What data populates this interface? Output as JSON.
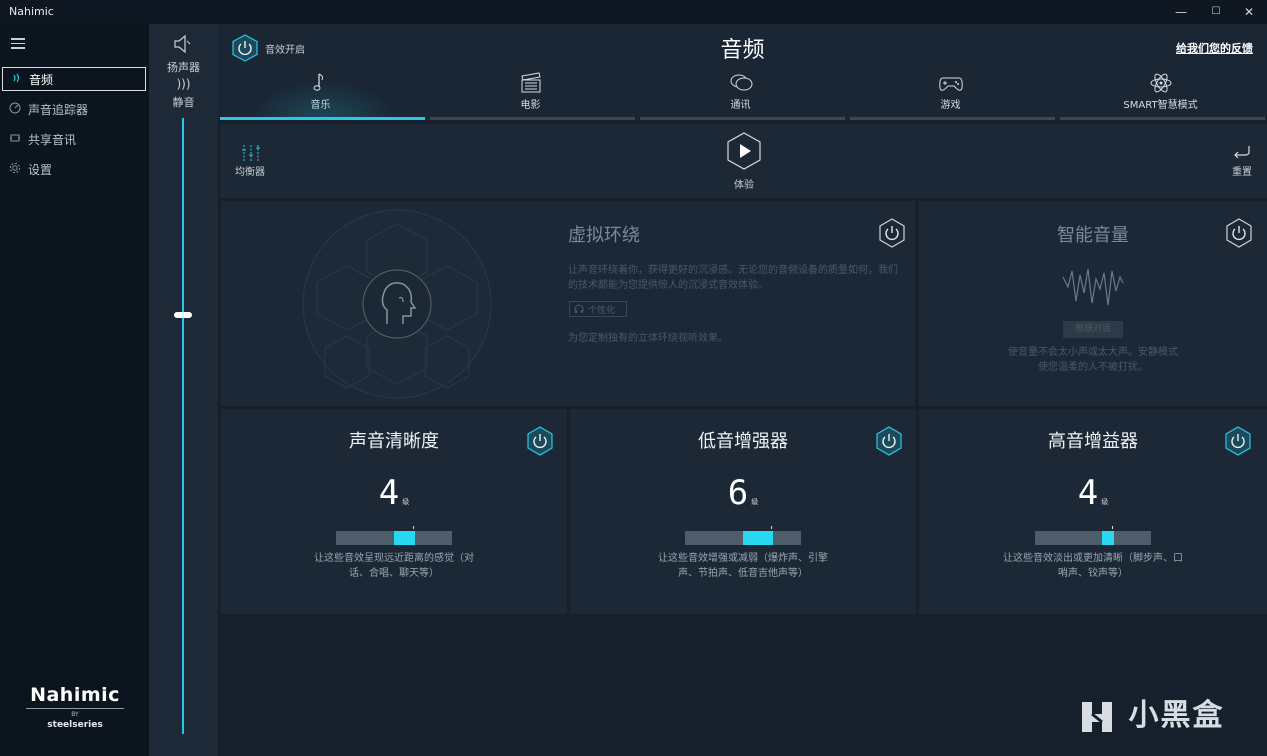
{
  "app": {
    "title": "Nahimic"
  },
  "window_controls": {
    "minimize": "—",
    "maximize": "☐",
    "close": "✕"
  },
  "nav": {
    "items": [
      {
        "label": "音频",
        "icon": "audio-wave-icon"
      },
      {
        "label": "声音追踪器",
        "icon": "radar-icon"
      },
      {
        "label": "共享音讯",
        "icon": "share-audio-icon"
      },
      {
        "label": "设置",
        "icon": "gear-icon"
      }
    ]
  },
  "logo": {
    "brand": "Nahimic",
    "by": "BY",
    "partner": "steelseries"
  },
  "volume": {
    "device_label": "扬声器",
    "mute_label": "静音",
    "level": 0.68
  },
  "header": {
    "sfx_label": "音效开启",
    "title": "音频",
    "feedback_link": "给我们您的反馈"
  },
  "tabs": [
    {
      "label": "音乐",
      "icon": "music-note-icon"
    },
    {
      "label": "电影",
      "icon": "clapperboard-icon"
    },
    {
      "label": "通讯",
      "icon": "chat-bubble-icon"
    },
    {
      "label": "游戏",
      "icon": "gamepad-icon"
    },
    {
      "label": "SMART智慧模式",
      "icon": "atom-icon"
    }
  ],
  "toolbar": {
    "equalizer_label": "均衡器",
    "try_label": "体验",
    "reset_label": "重置"
  },
  "virtual_surround": {
    "title": "虚拟环绕",
    "desc": "让声音环绕着你，获得更好的沉浸感。无论您的音频设备的质量如何，我们的技术都能为您提供惊人的沉浸式音效体验。",
    "personalize_button": "个性化",
    "note": "为您定制独有的立体环绕视听效果。"
  },
  "smart_volume": {
    "title": "智能音量",
    "button": "根据对话",
    "desc": "使音量不会太小声或太大声。安静模式使您温柔的人不被打扰。"
  },
  "effects": [
    {
      "title": "声音清晰度",
      "level": "4",
      "unit": "级",
      "fill_start": 0.5,
      "fill_end": 0.68,
      "desc": "让这些音效呈现远近距离的感觉（对话、合唱、聊天等）"
    },
    {
      "title": "低音增强器",
      "level": "6",
      "unit": "级",
      "fill_start": 0.5,
      "fill_end": 0.76,
      "desc": "让这些音效增强或减弱（爆炸声、引擎声、节拍声、低音吉他声等）"
    },
    {
      "title": "高音增益器",
      "level": "4",
      "unit": "级",
      "fill_start": 0.58,
      "fill_end": 0.68,
      "desc": "让这些音效淡出或更加清晰（脚步声、口哨声、铰声等）"
    }
  ],
  "watermark": {
    "text": "小黑盒"
  },
  "colors": {
    "accent": "#27c9e6",
    "background": "#16202c",
    "panel": "#1c2836"
  }
}
